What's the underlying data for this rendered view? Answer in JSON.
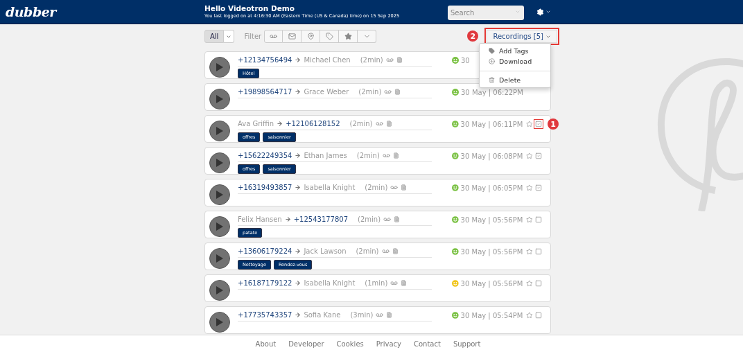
{
  "header": {
    "logo": "dubber",
    "greeting": "Hello Videotron Demo",
    "last_login": "You last logged on at 4:16:30 AM (Eastern Time (US & Canada) time) on 15 Sep 2025",
    "search": {
      "placeholder": "Search"
    }
  },
  "toolbar": {
    "view": {
      "label": "All",
      "selected": true
    },
    "filter_label": "Filter",
    "filters": [
      {
        "kind": "voicemail"
      },
      {
        "kind": "mail"
      },
      {
        "kind": "location"
      },
      {
        "kind": "tag"
      },
      {
        "kind": "star"
      },
      {
        "kind": "more"
      }
    ],
    "recordings_button": {
      "label": "Recordings [5]",
      "annotation": "2"
    }
  },
  "menu": {
    "items": [
      {
        "label": "Add Tags",
        "kind": "tag"
      },
      {
        "label": "Download",
        "kind": "download"
      },
      {
        "label": "Delete",
        "kind": "delete"
      }
    ]
  },
  "recordings": [
    {
      "from": {
        "text": "+12134756494",
        "kind": "number"
      },
      "to": {
        "text": "Michael Chen",
        "kind": "name"
      },
      "duration": "(2min)",
      "tags": [
        "Hôtel"
      ],
      "color": "#7ac143",
      "date": "30"
    },
    {
      "from": {
        "text": "+19898564717",
        "kind": "number"
      },
      "to": {
        "text": "Grace Weber",
        "kind": "name"
      },
      "duration": "(2min)",
      "color": "#7ac143",
      "date": "30 May | 06:22PM"
    },
    {
      "from": {
        "text": "Ava Griffin",
        "kind": "name"
      },
      "to": {
        "text": "+12106128152",
        "kind": "number"
      },
      "duration": "(2min)",
      "tags": [
        "offres",
        "saisonnier"
      ],
      "color": "#7ac143",
      "date": "30 May | 06:11PM",
      "checked": true,
      "annotation": "1"
    },
    {
      "from": {
        "text": "+15622249354",
        "kind": "number"
      },
      "to": {
        "text": "Ethan James",
        "kind": "name"
      },
      "duration": "(2min)",
      "tags": [
        "offres",
        "saisonnier"
      ],
      "color": "#7ac143",
      "date": "30 May | 06:08PM",
      "checked": true
    },
    {
      "from": {
        "text": "+16319493857",
        "kind": "number"
      },
      "to": {
        "text": "Isabella Knight",
        "kind": "name"
      },
      "duration": "(2min)",
      "color": "#7ac143",
      "date": "30 May | 06:05PM",
      "checked": true
    },
    {
      "from": {
        "text": "Felix Hansen",
        "kind": "name"
      },
      "to": {
        "text": "+12543177807",
        "kind": "number"
      },
      "duration": "(2min)",
      "tags": [
        "patate"
      ],
      "color": "#7ac143",
      "date": "30 May | 05:56PM",
      "checked": false
    },
    {
      "from": {
        "text": "+13606179224",
        "kind": "number"
      },
      "to": {
        "text": "Jack Lawson",
        "kind": "name"
      },
      "duration": "(2min)",
      "tags": [
        "Nettoyage",
        "Rendez-vous"
      ],
      "color": "#7ac143",
      "date": "30 May | 05:56PM",
      "checked": false
    },
    {
      "from": {
        "text": "+16187179122",
        "kind": "number"
      },
      "to": {
        "text": "Isabella Knight",
        "kind": "name"
      },
      "duration": "(1min)",
      "color": "#f0c419",
      "date": "30 May | 05:56PM",
      "checked": false
    },
    {
      "from": {
        "text": "+17735743357",
        "kind": "number"
      },
      "to": {
        "text": "Sofia Kane",
        "kind": "name"
      },
      "duration": "(3min)",
      "color": "#7ac143",
      "date": "30 May | 05:54PM",
      "checked": false
    }
  ],
  "footer": {
    "links": [
      "About",
      "Developer",
      "Cookies",
      "Privacy",
      "Contact",
      "Support"
    ]
  }
}
